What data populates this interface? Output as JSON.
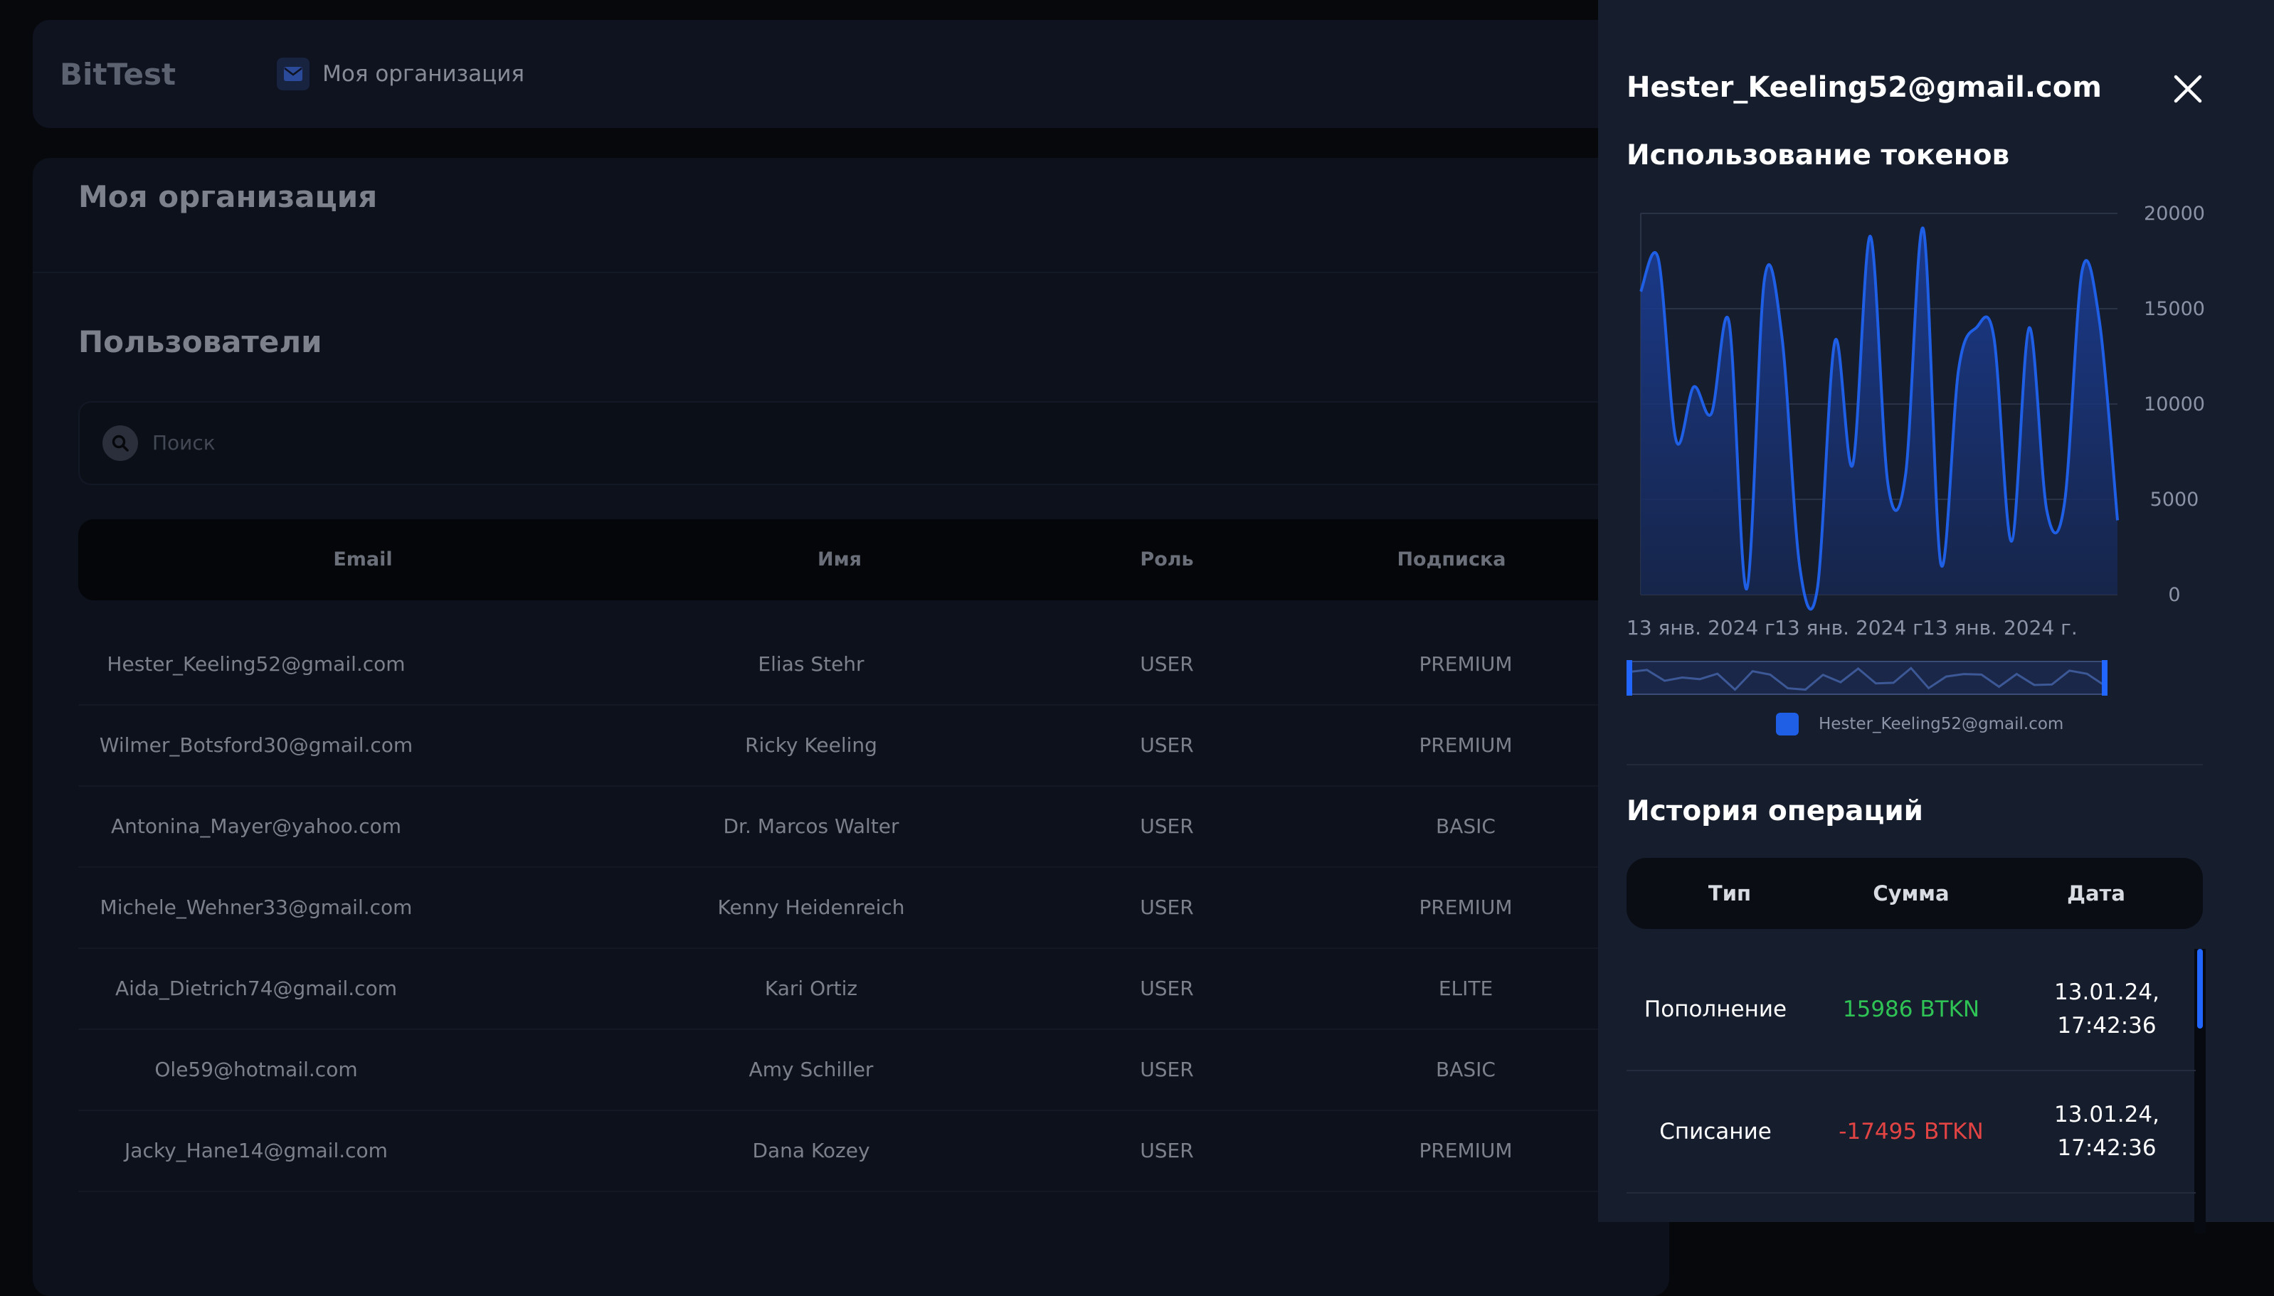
{
  "app": {
    "logo": "BitTest",
    "org_chip": "Моя организация",
    "page_title": "Моя организация",
    "users_title": "Пользователи",
    "search_placeholder": "Поиск"
  },
  "table": {
    "headers": {
      "email": "Email",
      "name": "Имя",
      "role": "Роль",
      "subscription": "Подписка"
    },
    "rows": [
      {
        "email": "Hester_Keeling52@gmail.com",
        "name": "Elias Stehr",
        "role": "USER",
        "subscription": "PREMIUM"
      },
      {
        "email": "Wilmer_Botsford30@gmail.com",
        "name": "Ricky Keeling",
        "role": "USER",
        "subscription": "PREMIUM"
      },
      {
        "email": "Antonina_Mayer@yahoo.com",
        "name": "Dr. Marcos Walter",
        "role": "USER",
        "subscription": "BASIC"
      },
      {
        "email": "Michele_Wehner33@gmail.com",
        "name": "Kenny Heidenreich",
        "role": "USER",
        "subscription": "PREMIUM"
      },
      {
        "email": "Aida_Dietrich74@gmail.com",
        "name": "Kari Ortiz",
        "role": "USER",
        "subscription": "ELITE"
      },
      {
        "email": "Ole59@hotmail.com",
        "name": "Amy Schiller",
        "role": "USER",
        "subscription": "BASIC"
      },
      {
        "email": "Jacky_Hane14@gmail.com",
        "name": "Dana Kozey",
        "role": "USER",
        "subscription": "PREMIUM"
      }
    ]
  },
  "drawer": {
    "title": "Hester_Keeling52@gmail.com",
    "usage_title": "Использование токенов",
    "ops_title": "История операций",
    "ops_headers": {
      "type": "Тип",
      "amount": "Сумма",
      "date": "Дата"
    },
    "ops": [
      {
        "type": "Пополнение",
        "amount": "15986 BTKN",
        "sign": "positive",
        "date": "13.01.24,\n17:42:36"
      },
      {
        "type": "Списание",
        "amount": "-17495 BTKN",
        "sign": "negative",
        "date": "13.01.24,\n17:42:36"
      }
    ]
  },
  "chart_data": {
    "type": "area",
    "legend": [
      "Hester_Keeling52@gmail.com"
    ],
    "x_tick_labels": [
      "13 янв. 2024 г.",
      "13 янв. 2024 г.",
      "13 янв. 2024 г."
    ],
    "y_ticks": [
      0,
      5000,
      10000,
      15000,
      20000
    ],
    "ylim": [
      0,
      20000
    ],
    "grid": true,
    "y_axis_position": "right",
    "color": "#1f5fe6",
    "series": [
      {
        "name": "Hester_Keeling52@gmail.com",
        "values": [
          15900,
          17600,
          8100,
          10900,
          9500,
          14300,
          300,
          16500,
          13500,
          1500,
          300,
          13300,
          6800,
          18800,
          5800,
          6300,
          19200,
          1600,
          11800,
          14000,
          13500,
          2800,
          14000,
          4400,
          4800,
          17000,
          14200,
          3900
        ]
      }
    ]
  }
}
